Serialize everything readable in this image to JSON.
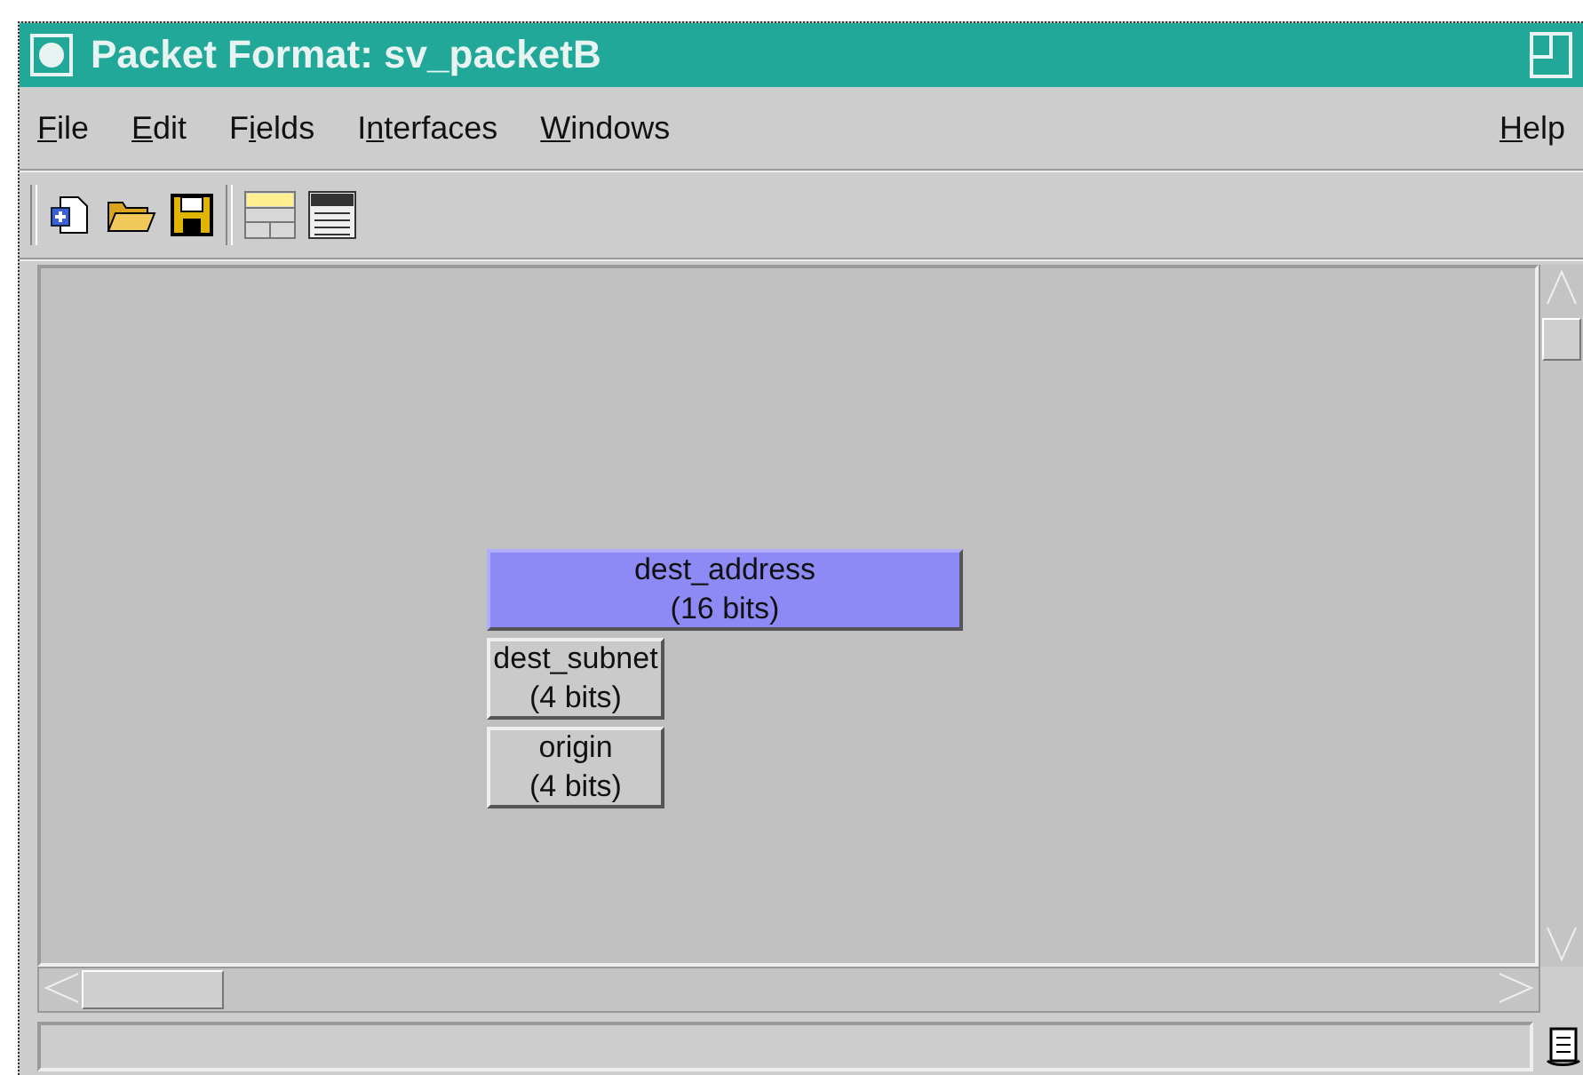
{
  "window": {
    "title": "Packet Format: sv_packetB"
  },
  "menu": [
    {
      "key": "F",
      "post": "ile"
    },
    {
      "key": "E",
      "post": "dit"
    },
    {
      "pre": "F",
      "key": "i",
      "post": "elds"
    },
    {
      "pre": "I",
      "key": "n",
      "post": "terfaces"
    },
    {
      "key": "W",
      "post": "indows"
    }
  ],
  "help_menu": {
    "key": "H",
    "post": "elp"
  },
  "toolbar": [
    {
      "kind": "new"
    },
    {
      "kind": "open"
    },
    {
      "kind": "save"
    },
    {
      "kind": "separator"
    },
    {
      "kind": "layout"
    },
    {
      "kind": "attr"
    }
  ],
  "fields": [
    {
      "name": "dest_address",
      "size": "(16 bits)",
      "selected": true,
      "kind": "wide"
    },
    {
      "name": "dest_subnet",
      "size": "(4 bits)",
      "selected": false,
      "kind": "narrow"
    },
    {
      "name": "origin",
      "size": "(4 bits)",
      "selected": false,
      "kind": "narrow"
    }
  ]
}
